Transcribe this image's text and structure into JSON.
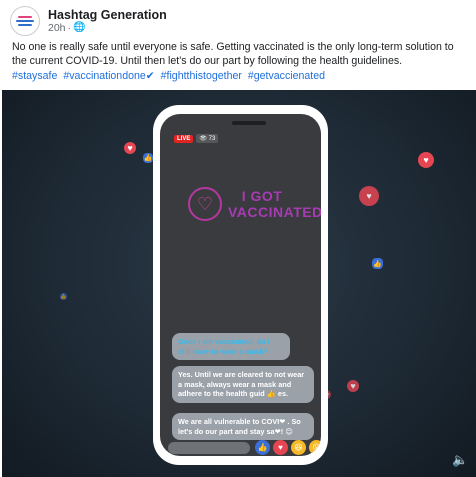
{
  "post": {
    "page_name": "Hashtag Generation",
    "time": "20h",
    "separator": "·",
    "privacy_icon": "globe-icon",
    "caption": "No one is really safe until everyone is safe. Getting vaccinated is the only long-term solution to the current COVID-19. Until then let's do our part by following the health guidelines.",
    "hashtags": [
      "#staysafe",
      "#vaccinationdone✔",
      "#fightthistogether",
      "#getvaccienated"
    ]
  },
  "video": {
    "live_label": "LIVE",
    "viewer_count": "👁 73",
    "logo_text": "I GOT VACCINATED",
    "messages": [
      "Once I am vaccinated, do I still have to wear a mask?",
      "Yes. Until we are cleared to not wear a mask,  always wear a mask and adhere to the health guid 👍 es.",
      "We are all vulnerable to COVI❤ . So let's do our part and stay sa❤! 😊"
    ],
    "volume_icon": "volume-icon"
  },
  "colors": {
    "hashtag_blue": "#216fdb",
    "heart_red": "#e64552",
    "like_blue": "#3a6fd8",
    "logo_purple": "#a83bb3"
  }
}
